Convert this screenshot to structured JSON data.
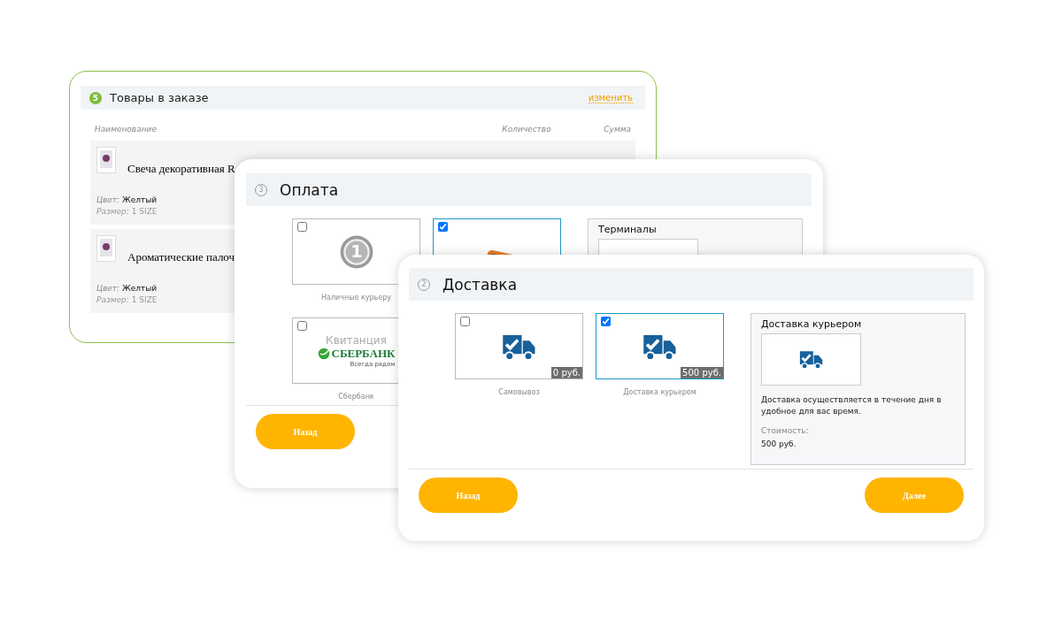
{
  "order_card": {
    "badge": "5",
    "title": "Товары в заказе",
    "edit_link": "изменить",
    "columns": [
      "Наименование",
      "Количество",
      "Сумма"
    ],
    "items": [
      {
        "name": "Свеча декоративная R",
        "color_label": "Цвет:",
        "color_value": "Желтый",
        "size_label": "Размер:",
        "size": "1 SIZE"
      },
      {
        "name": "Ароматические палоч",
        "color_label": "Цвет:",
        "color_value": "Желтый",
        "size_label": "Размер:",
        "size": "1 SIZE"
      }
    ]
  },
  "payment_card": {
    "step": "3",
    "title": "Оплата",
    "options": [
      {
        "kind": "coin",
        "digit": "1",
        "label": "Наличные курьеру",
        "selected": false
      },
      {
        "kind": "terminal",
        "selected": true
      },
      {
        "kind": "receipt",
        "caption": "Квитанция",
        "brand": "СБЕРБАНК",
        "slogan": "Всегда рядом",
        "label": "Сбербанк",
        "selected": false
      }
    ],
    "detail": {
      "title": "Терминалы"
    },
    "back_button": "Назад"
  },
  "delivery_card": {
    "step": "2",
    "title": "Доставка",
    "options": [
      {
        "label": "Самовывоз",
        "price": "0 руб.",
        "selected": false
      },
      {
        "label": "Доставка курьером",
        "price": "500 руб.",
        "selected": true
      }
    ],
    "detail": {
      "title": "Доставка курьером",
      "description": "Доставка осуществляется в течение дня в удобное для вас время.",
      "cost_label": "Стоимость:",
      "cost": "500 руб."
    },
    "back_button": "Назад",
    "next_button": "Далее"
  }
}
